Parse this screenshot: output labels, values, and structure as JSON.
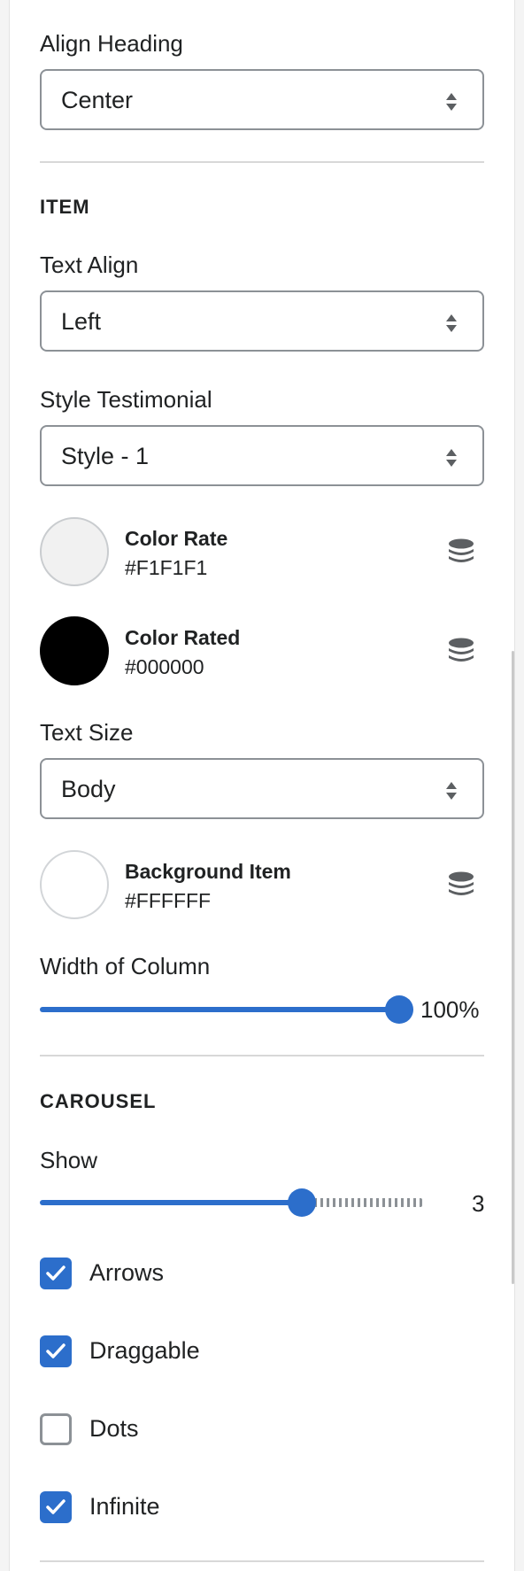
{
  "heading_align": {
    "label": "Align Heading",
    "value": "Center"
  },
  "item_section": {
    "title": "ITEM",
    "text_align": {
      "label": "Text Align",
      "value": "Left"
    },
    "style_testimonial": {
      "label": "Style Testimonial",
      "value": "Style - 1"
    },
    "color_rate": {
      "name": "Color Rate",
      "hex": "#F1F1F1",
      "icon": "database-icon"
    },
    "color_rated": {
      "name": "Color Rated",
      "hex": "#000000",
      "icon": "database-icon"
    },
    "text_size": {
      "label": "Text Size",
      "value": "Body"
    },
    "background_item": {
      "name": "Background Item",
      "hex": "#FFFFFF",
      "icon": "database-icon"
    },
    "width_of_column": {
      "label": "Width of Column",
      "value": 100,
      "display": "100%"
    }
  },
  "carousel_section": {
    "title": "CAROUSEL",
    "show": {
      "label": "Show",
      "value": 3,
      "display": "3",
      "fraction": 0.66
    },
    "checkboxes": [
      {
        "label": "Arrows",
        "checked": true
      },
      {
        "label": "Draggable",
        "checked": true
      },
      {
        "label": "Dots",
        "checked": false
      },
      {
        "label": "Infinite",
        "checked": true
      }
    ]
  },
  "colors": {
    "accent": "#2C6ECB",
    "border": "#8C9196",
    "divider": "#D8D8D8"
  }
}
